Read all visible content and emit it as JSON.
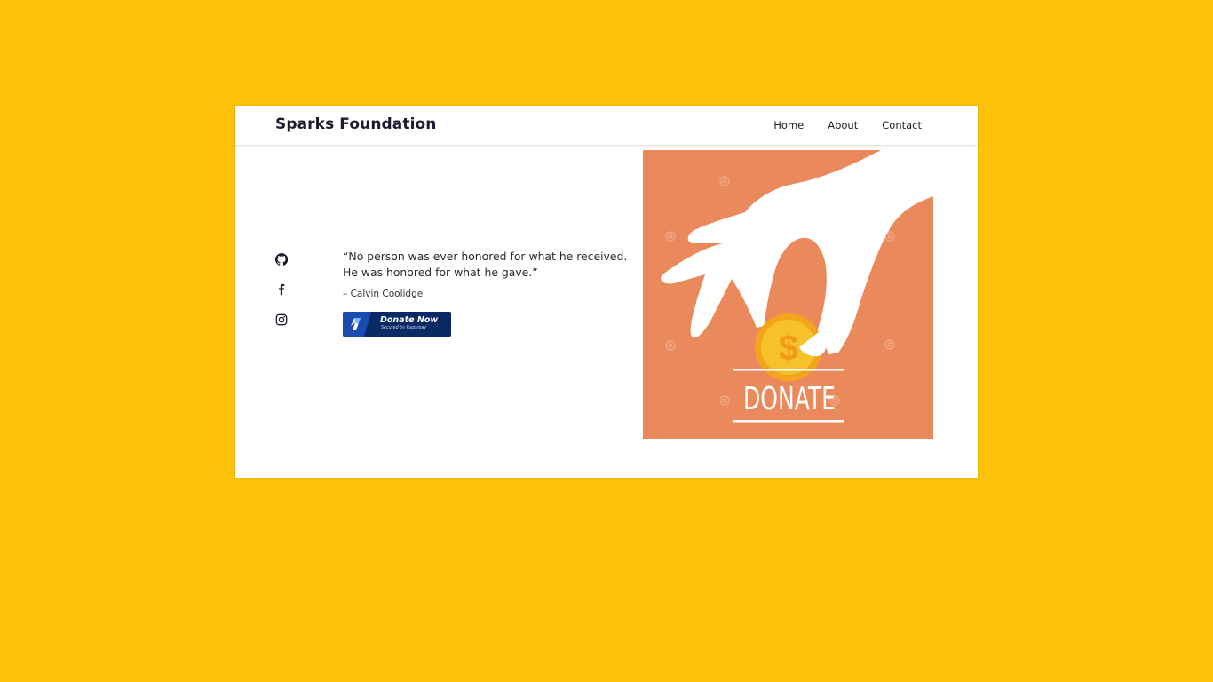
{
  "header": {
    "brand": "Sparks Foundation",
    "nav": [
      {
        "label": "Home"
      },
      {
        "label": "About"
      },
      {
        "label": "Contact"
      }
    ]
  },
  "social": [
    {
      "icon": "github-icon"
    },
    {
      "icon": "facebook-icon"
    },
    {
      "icon": "instagram-icon"
    }
  ],
  "main": {
    "quote": "“No person was ever honored for what he received. He was honored for what he gave.”",
    "author": "– Calvin Coolidge",
    "donate_button": {
      "label": "Donate Now",
      "sublabel": "Secured by Razorpay"
    }
  },
  "hero": {
    "caption": "DONATE",
    "coin_symbol": "$"
  },
  "colors": {
    "page_background": "#FFC20A",
    "hero_background": "#EA8A5C",
    "button_background": "#0A2A66"
  }
}
